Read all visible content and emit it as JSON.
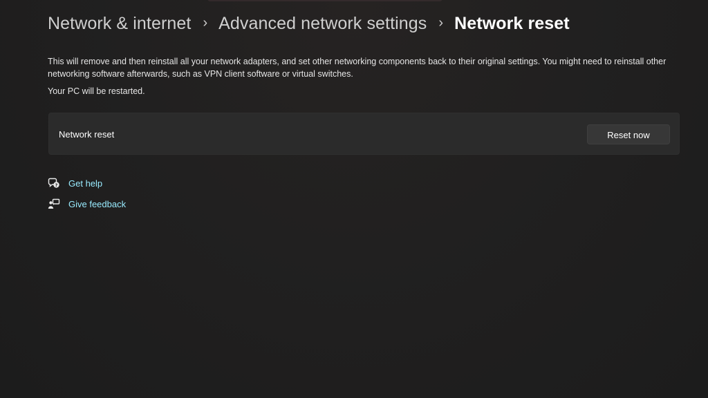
{
  "breadcrumb": {
    "items": [
      "Network & internet",
      "Advanced network settings",
      "Network reset"
    ],
    "separator": "›"
  },
  "description": "This will remove and then reinstall all your network adapters, and set other networking components back to their original settings. You might need to reinstall other networking software afterwards, such as VPN client software or virtual switches.",
  "restart_note": "Your PC will be restarted.",
  "reset_card": {
    "label": "Network reset",
    "button_label": "Reset now"
  },
  "links": [
    {
      "label": "Get help",
      "icon": "get-help-icon"
    },
    {
      "label": "Give feedback",
      "icon": "give-feedback-icon"
    }
  ],
  "colors": {
    "background": "#202020",
    "card": "#2b2b2b",
    "button": "#373737",
    "link": "#99ebff"
  }
}
